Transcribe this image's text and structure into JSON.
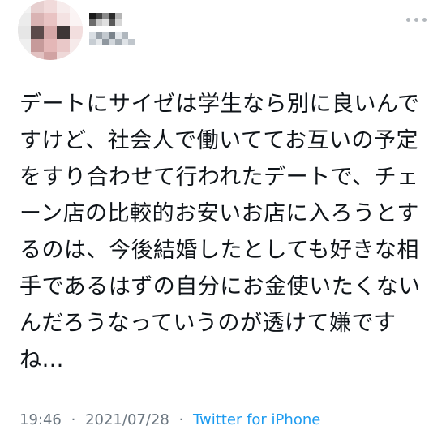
{
  "tweet": {
    "author": {
      "avatar_icon": "avatar-pixelated-icon",
      "name_icon": "pixelated-name-icon"
    },
    "more_icon": "more-horizontal-icon",
    "text": "デートにサイゼは学生なら別に良いんですけど、社会人で働いててお互いの予定をすり合わせて行われたデートで、チェーン店の比較的お安いお店に入ろうとするのは、今後結婚したとしても好きな相手であるはずの自分にお金使いたくないんだろうなっていうのが透けて嫌ですね…",
    "meta": {
      "time": "19:46",
      "separator": "·",
      "date": "2021/07/28",
      "source": "Twitter for iPhone"
    },
    "colors": {
      "text": "#0f1419",
      "meta": "#6b7680",
      "link": "#1d9bf0"
    }
  }
}
